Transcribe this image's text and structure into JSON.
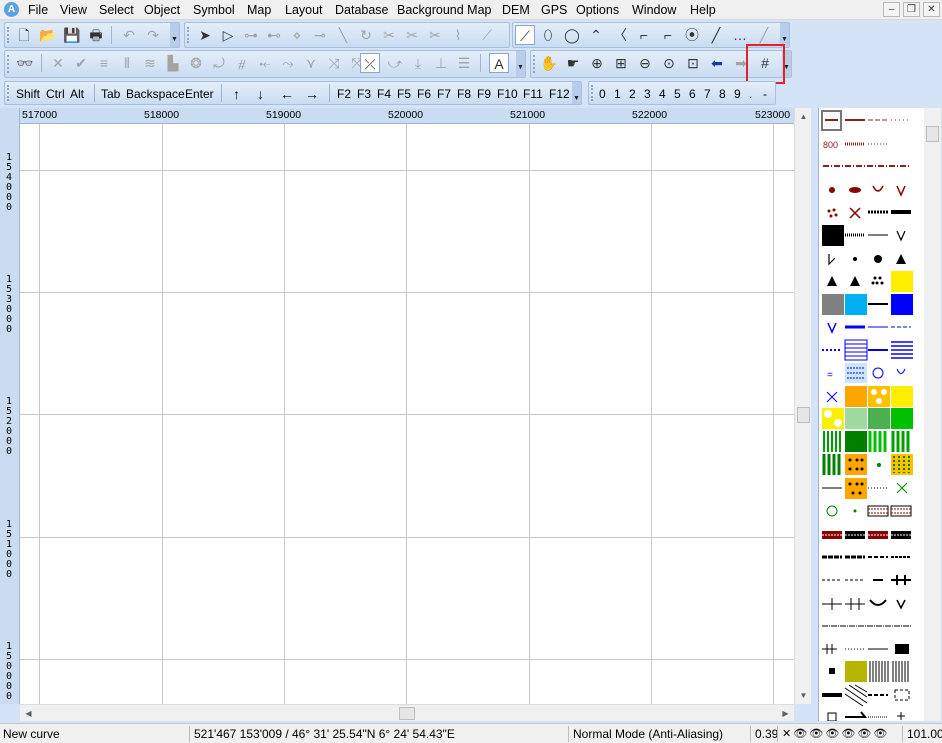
{
  "menu": {
    "app_icon_text": "A",
    "items": [
      "File",
      "View",
      "Select",
      "Object",
      "Symbol",
      "Map",
      "Layout",
      "Database",
      "Background Map",
      "DEM",
      "GPS",
      "Options",
      "Window",
      "Help"
    ],
    "window_controls": [
      "minimize-icon",
      "restore-icon",
      "close-icon"
    ]
  },
  "toolbar_row1": {
    "file_buttons": [
      "new-icon",
      "open-icon",
      "save-icon",
      "print-icon"
    ],
    "edit_buttons": [
      "undo-icon",
      "redo-icon"
    ],
    "select_buttons": [
      "select-object-icon",
      "edit-point-icon",
      "add-point-icon",
      "delete-point-icon",
      "corner-point-icon",
      "dash-point-icon",
      "cut-icon",
      "rotate-icon",
      "scissors-icon",
      "cut-hole-icon",
      "fill-icon",
      "smooth-icon"
    ],
    "draw_buttons": [
      "curve-icon",
      "ellipse-icon",
      "circle-icon",
      "zigzag-icon",
      "freehand-icon",
      "rectangle-icon",
      "steps-icon",
      "polyline-icon",
      "straight-line-icon",
      "dotted-line-icon",
      "line-icon"
    ]
  },
  "toolbar_row2": {
    "edit_buttons": [
      "binoculars-icon",
      "delete-icon",
      "check-icon",
      "align-icon",
      "parallel-icon",
      "stack-icon",
      "stairs-icon",
      "hatch-icon",
      "rotate-pattern-icon",
      "cross-icon",
      "merge-icon",
      "connect-icon",
      "fork-icon",
      "split-icon",
      "fill-area-icon",
      "mirror-icon",
      "symbol-text-icon",
      "align-text-icon",
      "level-icon",
      "bar-icon"
    ],
    "text_button": "text-icon",
    "view_buttons": [
      "hand-icon",
      "pan-icon",
      "zoom-in-icon",
      "zoom-window-icon",
      "zoom-out-icon",
      "zoom-fit-icon",
      "zoom-page-icon",
      "back-icon",
      "forward-icon",
      "grid-icon"
    ]
  },
  "toolbar_row3": {
    "modifier_keys": [
      "Shift",
      "Ctrl",
      "Alt"
    ],
    "edit_keys": [
      "Tab",
      "Backspace",
      "Enter"
    ],
    "arrow_keys": [
      "↑",
      "↓",
      "←",
      "→"
    ],
    "function_keys": [
      "F2",
      "F3",
      "F4",
      "F5",
      "F6",
      "F7",
      "F8",
      "F9",
      "F10",
      "F11",
      "F12"
    ],
    "number_keys": [
      "0",
      "1",
      "2",
      "3",
      "4",
      "5",
      "6",
      "7",
      "8",
      "9",
      ".",
      "-"
    ]
  },
  "ruler": {
    "x_labels": [
      "517000",
      "518000",
      "519000",
      "520000",
      "521000",
      "522000",
      "523000"
    ],
    "y_labels": [
      "154000",
      "153000",
      "152000",
      "151000",
      "150000"
    ]
  },
  "status": {
    "mode_text": "New curve",
    "coordinates": "521'467  153'009  /  46°  31'  25.54\"N  6°  24'  54.43\"E",
    "render_mode": "Normal Mode (Anti-Aliasing)",
    "scale": "0.39",
    "zoom": "101.00"
  },
  "colors": {
    "accent_highlight": "#e2232a",
    "toolbar_bg": "#c9dcf2",
    "grid_line": "#c8c8c8"
  }
}
